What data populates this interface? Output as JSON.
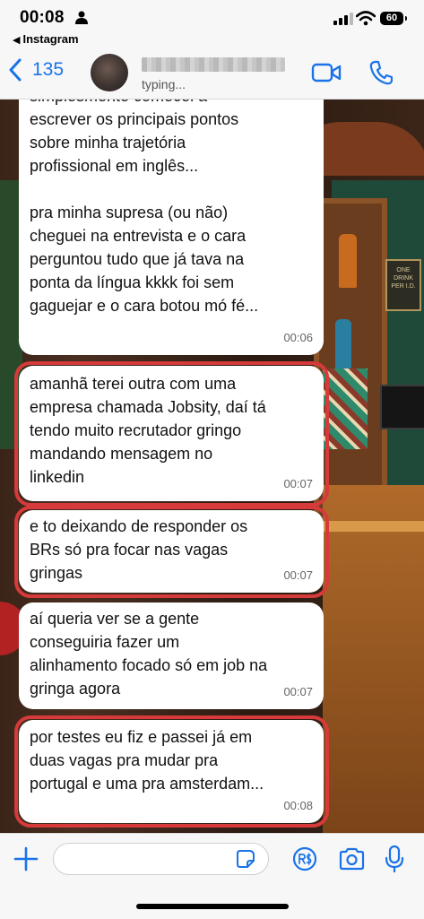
{
  "status_bar": {
    "time": "00:08",
    "back_app": "Instagram",
    "battery": "60"
  },
  "header": {
    "back_count": "135",
    "status": "typing..."
  },
  "background": {
    "sign_text": "ONE DRINK PER I.D."
  },
  "messages": [
    {
      "text": "simplesmente comecei a\nescrever os principais pontos\nsobre minha trajetória\nprofissional em inglês...\n\npra minha supresa (ou não)\ncheguei na entrevista e o cara\nperguntou tudo que já tava na\nponta da língua kkkk foi sem\ngaguejar e o cara botou mó fé...",
      "time": "00:06",
      "highlighted": false
    },
    {
      "text": "amanhã terei outra com uma\nempresa chamada Jobsity, daí tá\ntendo muito recrutador gringo\nmandando mensagem no\nlinkedin",
      "time": "00:07",
      "highlighted": true
    },
    {
      "text": "e to deixando de responder os\nBRs só pra focar nas vagas\ngringas",
      "time": "00:07",
      "highlighted": true
    },
    {
      "text": "aí queria ver se a gente\nconseguiria fazer um\nalinhamento focado só em job na\ngringa agora",
      "time": "00:07",
      "highlighted": false
    },
    {
      "text": "por testes eu fiz e passei já em\nduas vagas pra mudar pra\nportugal e uma pra amsterdam...",
      "time": "00:08",
      "highlighted": true
    }
  ],
  "input": {
    "value": "",
    "placeholder": ""
  },
  "icons": {
    "back": "chevron-left-icon",
    "video": "video-camera-icon",
    "phone": "phone-icon",
    "plus": "plus-icon",
    "sticker": "sticker-icon",
    "payment": "payment-icon",
    "camera": "camera-icon",
    "mic": "microphone-icon"
  },
  "colors": {
    "accent": "#1a73e8",
    "highlight": "#d63a3a",
    "bubble": "#ffffff"
  }
}
